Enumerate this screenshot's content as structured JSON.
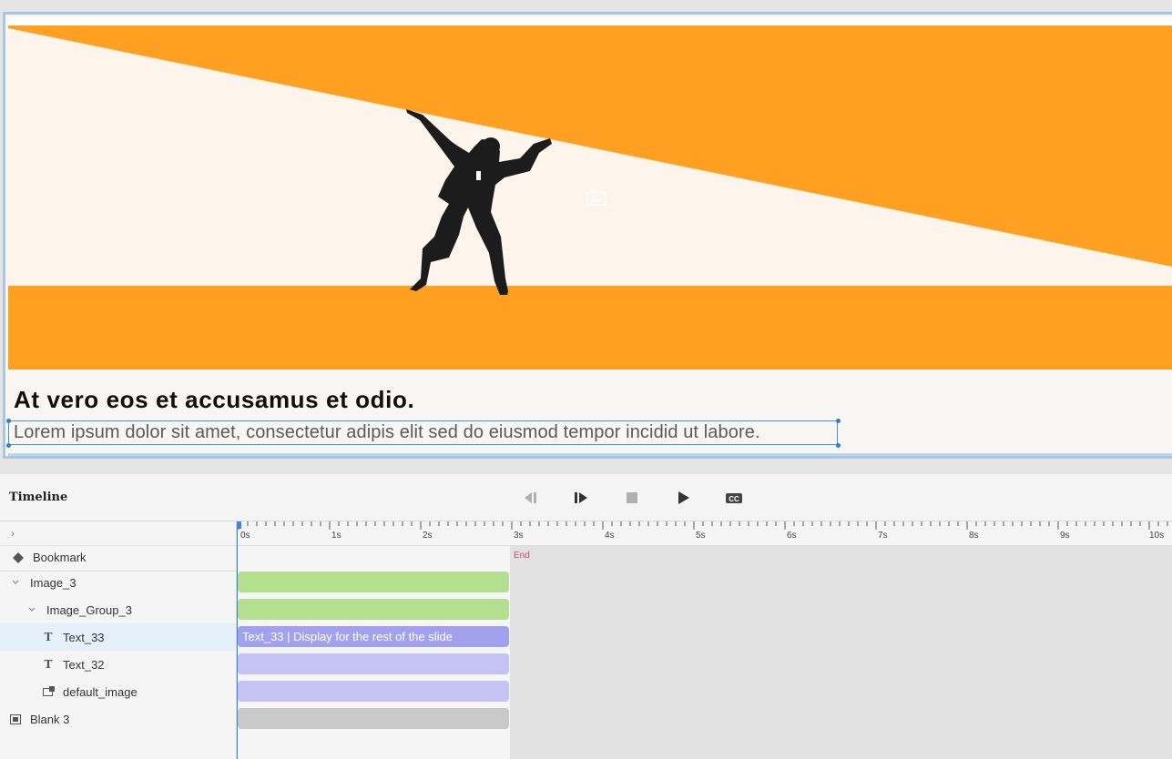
{
  "slide": {
    "heading": "At vero eos et accusamus et odio.",
    "body": "Lorem ipsum dolor sit amet, consectetur adipis elit sed do eiusmod tempor incidid ut labore."
  },
  "timeline": {
    "title": "Timeline",
    "controls": {
      "rewind_icon": "step-back-icon",
      "play_from_icon": "play-from-here-icon",
      "stop_icon": "stop-icon",
      "play_icon": "play-icon",
      "cc_icon": "closed-captions-icon"
    },
    "ruler_labels": [
      "0s",
      "1s",
      "2s",
      "3s",
      "4s",
      "5s",
      "6s",
      "7s",
      "8s",
      "9s",
      "10s"
    ],
    "end_label": "End",
    "layers": [
      {
        "label": "Bookmark",
        "icon": "diamond-icon"
      },
      {
        "label": "Image_3",
        "icon": "chevron-down-icon"
      },
      {
        "label": "Image_Group_3",
        "icon": "chevron-down-icon"
      },
      {
        "label": "Text_33",
        "icon": "text-icon"
      },
      {
        "label": "Text_32",
        "icon": "text-icon"
      },
      {
        "label": "default_image",
        "icon": "image-icon"
      },
      {
        "label": "Blank 3",
        "icon": "slide-icon"
      }
    ],
    "bars": {
      "text_33": "Text_33 | Display for the rest of the slide"
    }
  },
  "colors": {
    "banner_orange": "#ffa022",
    "banner_cream": "#fdf5ec",
    "selection_blue": "#4a8fd1",
    "bar_green": "#b3df8e",
    "bar_blue": "#a2a1ee",
    "bar_lilac": "#c4c3f4",
    "end_marker": "#c5497a"
  }
}
